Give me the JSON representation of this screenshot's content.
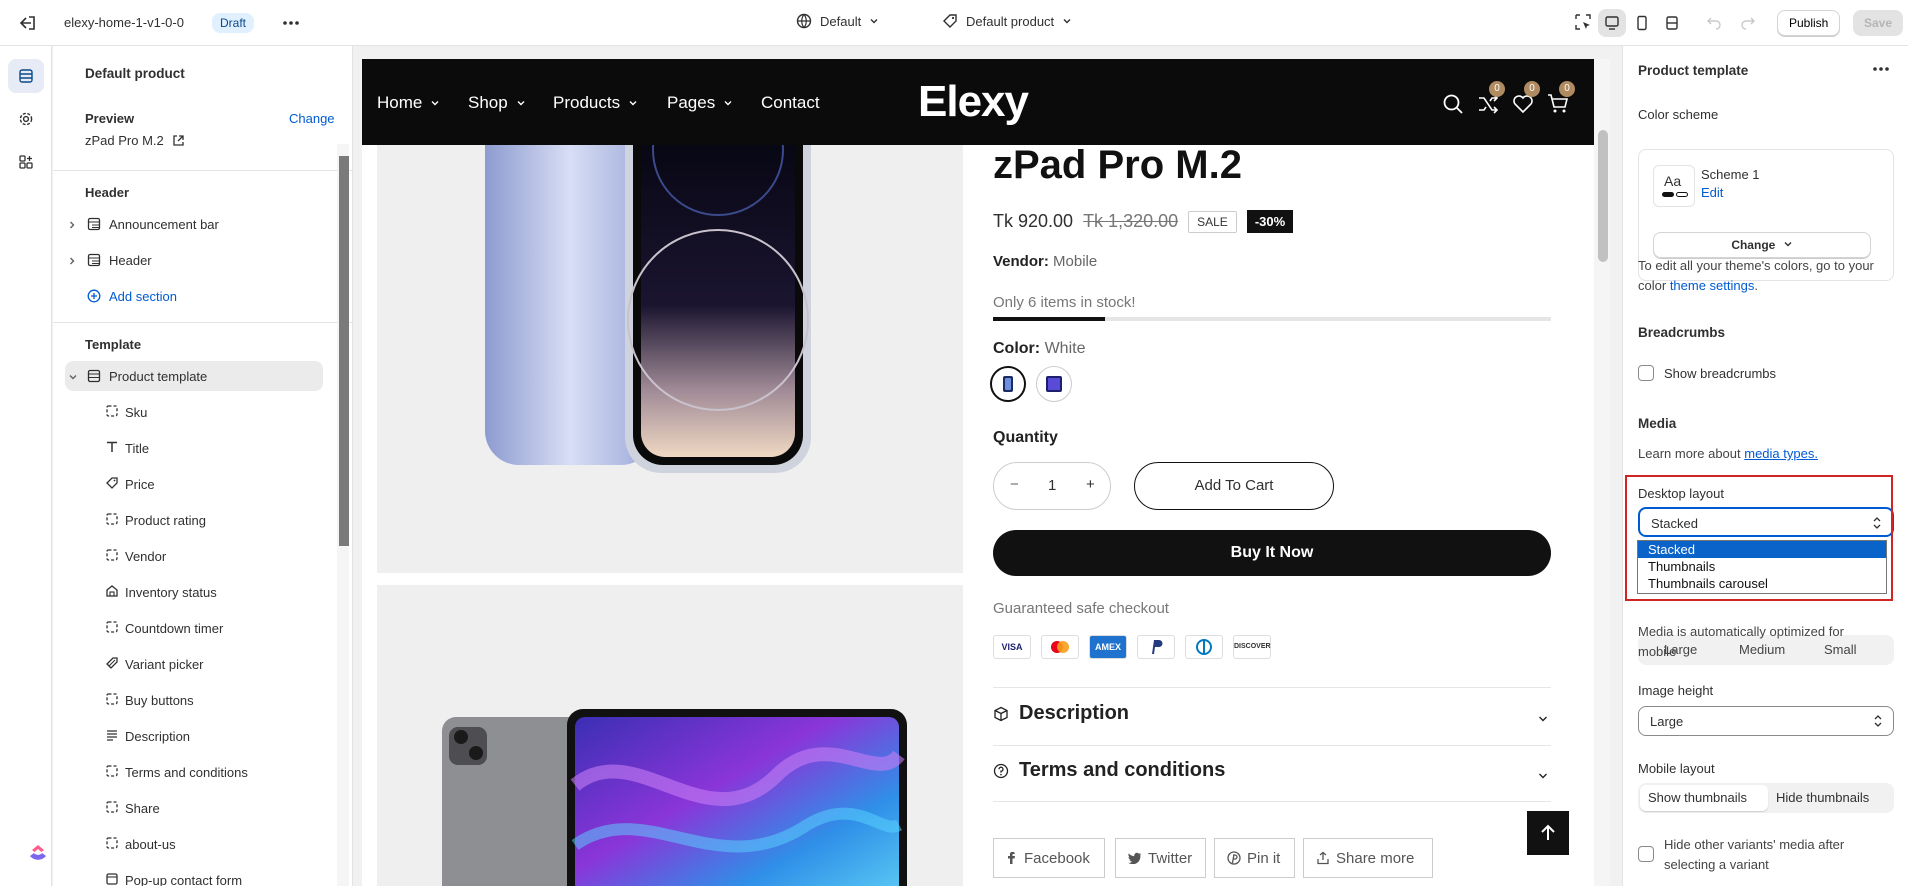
{
  "topbar": {
    "theme_name": "elexy-home-1-v1-0-0",
    "status_badge": "Draft",
    "theme_select": "Default",
    "template_select": "Default product",
    "publish_label": "Publish",
    "save_label": "Save"
  },
  "left_panel": {
    "title": "Default product",
    "preview_label": "Preview",
    "change_link": "Change",
    "preview_value": "zPad Pro M.2",
    "header_section": "Header",
    "header_items": [
      "Announcement bar",
      "Header"
    ],
    "add_section": "Add section",
    "template_section": "Template",
    "template_root": "Product template",
    "blocks": [
      "Sku",
      "Title",
      "Price",
      "Product rating",
      "Vendor",
      "Inventory status",
      "Countdown timer",
      "Variant picker",
      "Buy buttons",
      "Description",
      "Terms and conditions",
      "Share",
      "about-us",
      "Pop-up contact form"
    ]
  },
  "store": {
    "nav": [
      "Home",
      "Shop",
      "Products",
      "Pages",
      "Contact"
    ],
    "logo": "Elexy",
    "cart_counts": [
      "0",
      "0",
      "0"
    ],
    "product_title": "zPad Pro M.2",
    "price": "Tk 920.00",
    "compare_price": "Tk 1,320.00",
    "sale_badge": "SALE",
    "discount_badge": "-30%",
    "vendor_label": "Vendor:",
    "vendor_value": "Mobile",
    "stock_text": "Only 6 items in stock!",
    "stock_fraction": 0.2,
    "color_label": "Color:",
    "color_value": "White",
    "quantity_label": "Quantity",
    "quantity_value": "1",
    "add_to_cart": "Add To Cart",
    "buy_now": "Buy It Now",
    "guarantee": "Guaranteed safe checkout",
    "payment_methods": [
      "VISA",
      "MC",
      "AMEX",
      "PayPal",
      "Diners",
      "DISCOVER"
    ],
    "accordions": [
      "Description",
      "Terms and conditions"
    ],
    "share_buttons": [
      "Facebook",
      "Twitter",
      "Pin it",
      "Share more"
    ]
  },
  "right_panel": {
    "title": "Product template",
    "color_scheme_label": "Color scheme",
    "scheme_sample": "Aa",
    "scheme_name": "Scheme 1",
    "scheme_edit": "Edit",
    "scheme_change": "Change",
    "theme_colors_text": "To edit all your theme's colors, go to your color",
    "theme_settings_link": "theme settings",
    "breadcrumbs_head": "Breadcrumbs",
    "show_breadcrumbs": "Show breadcrumbs",
    "media_head": "Media",
    "media_text": "Learn more about",
    "media_link": "media types.",
    "desktop_layout_label": "Desktop layout",
    "desktop_layout_value": "Stacked",
    "desktop_layout_options": [
      "Stacked",
      "Thumbnails",
      "Thumbnails carousel"
    ],
    "media_size_options": [
      "Large",
      "Medium",
      "Small"
    ],
    "optimized_text": "Media is automatically optimized for mobile",
    "image_height_label": "Image height",
    "image_height_value": "Large",
    "mobile_layout_label": "Mobile layout",
    "mobile_layout_options": [
      "Show thumbnails",
      "Hide thumbnails"
    ],
    "hide_variants_text": "Hide other variants' media after selecting a variant"
  }
}
